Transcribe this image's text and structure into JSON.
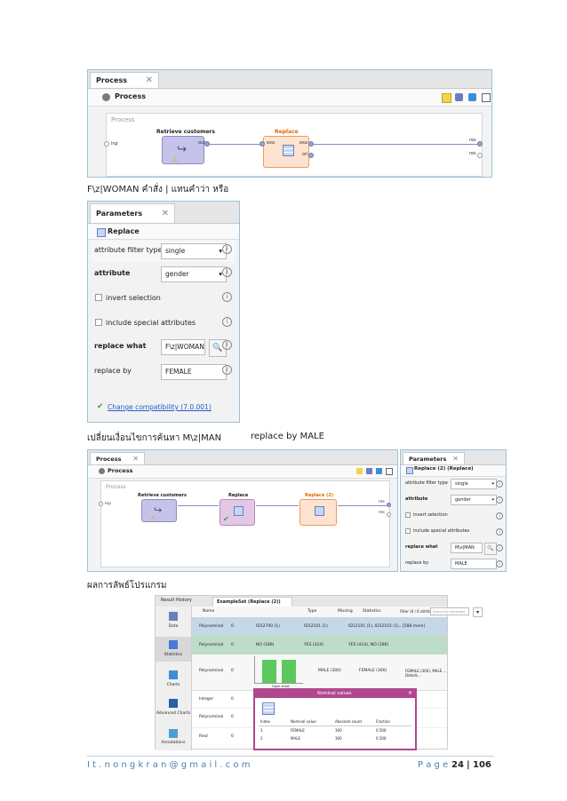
{
  "panel1": {
    "tab_label": "Process",
    "header_title": "Process",
    "canvas_label": "Process",
    "op1_title": "Retrieve customers",
    "op1_port_out": "out",
    "op2_title": "Replace",
    "op2_port_in": "exa",
    "op2_port_out": "exa",
    "op2_port_ori": "ori",
    "left_port": "inp",
    "right_port1": "res",
    "right_port2": "res"
  },
  "caption1": "F\\z|WOMAN  คำสั่ง | แทนคำว่า หรือ",
  "params": {
    "tab_label": "Parameters",
    "operator_label": "Replace",
    "rows": [
      {
        "label": "attribute filter type",
        "value": "single"
      },
      {
        "label": "attribute",
        "value": "gender"
      },
      {
        "label": "invert selection"
      },
      {
        "label": "include special attributes"
      },
      {
        "label": "replace what",
        "value": "F\\z|WOMAN"
      },
      {
        "label": "replace by",
        "value": "FEMALE"
      }
    ],
    "compat_link": "Change compatibility (7.0.001)"
  },
  "caption2_a": "เปลี่ยนเงื่อนไขการค้นหา  M\\z|MAN",
  "caption2_b": "replace by MALE",
  "panel3": {
    "tab_label": "Process",
    "header_title": "Process",
    "canvas_label": "Process",
    "op1_title": "Retrieve customers",
    "op2_title": "Replace",
    "op3_title": "Replace (2)",
    "left_port": "inp",
    "right_port1": "res",
    "right_port2": "res",
    "params_tab": "Parameters",
    "params_op": "Replace (2) (Replace)",
    "rows": [
      {
        "label": "attribute filter type",
        "value": "single"
      },
      {
        "label": "attribute",
        "value": "gender"
      },
      {
        "label": "invert selection"
      },
      {
        "label": "include special attributes"
      },
      {
        "label": "replace what",
        "value": "M\\z|MAN"
      },
      {
        "label": "replace by",
        "value": "MALE"
      }
    ]
  },
  "caption3": "ผลการลัพธ์โปรแกรม",
  "results": {
    "tab1": "Result History",
    "tab2": "ExampleSet (Replace (2))",
    "side": [
      "Data",
      "Statistics",
      "Charts",
      "Advanced Charts",
      "Annotations"
    ],
    "head": {
      "name": "Name",
      "type": "Type",
      "missing": "Missing",
      "statistics": "Statistics",
      "filter": "Filter (6 / 6 attributes):",
      "search": "Search for Attributes"
    },
    "rows": [
      {
        "type": "Polynominal",
        "missing": "0",
        "a": "ID12700 (1)",
        "b": "ID12101 (1)",
        "c": "ID12101 (1), ID12102 (1)...[588 more]"
      },
      {
        "type": "Polynominal",
        "missing": "0",
        "a": "NO (186)",
        "b": "YES (414)",
        "c": "YES (414), NO (186)"
      },
      {
        "type": "Polynominal",
        "missing": "0",
        "a": "MALE (300)",
        "b": "FEMALE (300)",
        "c": "FEMALE (300), MALE ... Details..."
      },
      {
        "type": "Integer",
        "missing": "0"
      },
      {
        "type": "Polynominal",
        "missing": "0"
      },
      {
        "type": "Real",
        "missing": "0"
      }
    ],
    "popup_title": "Nominal values",
    "popup_cols": [
      "Index",
      "Nominal value",
      "Absolute count",
      "Fraction"
    ],
    "popup_rows": [
      [
        "1",
        "FEMALE",
        "300",
        "0.500"
      ],
      [
        "2",
        "MALE",
        "300",
        "0.500"
      ]
    ],
    "open_chart": "Open chart"
  },
  "footer": {
    "email": "I t . n o n g k r a n @ g m a i l . c o m",
    "page_word": "P a g e",
    "page_num": "24",
    "sep": "|",
    "page_total": "106"
  }
}
